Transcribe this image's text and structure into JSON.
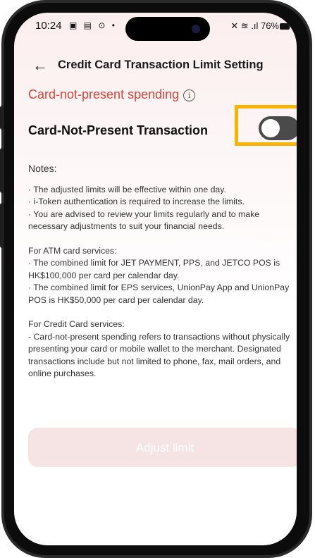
{
  "status_bar": {
    "time": "10:24",
    "left_icons": "▣ ▤ ⊙ •",
    "right_icons": "✕ ≋ .ıl",
    "battery": "76%"
  },
  "header": {
    "back_icon": "←",
    "title": "Credit Card Transaction Limit Setting"
  },
  "section": {
    "title": "Card-not-present spending",
    "info_icon": "i"
  },
  "toggle_row": {
    "label": "Card-Not-Present Transaction",
    "toggle_state": "off"
  },
  "notes": {
    "heading": "Notes:",
    "general": [
      "· The adjusted limits will be effective within one day.",
      "· i-Token authentication is required to increase the limits.",
      "· You are advised to review your limits regularly and to make necessary adjustments to suit your financial needs."
    ],
    "atm_heading": "For ATM card services:",
    "atm": [
      "· The combined limit for JET PAYMENT, PPS, and JETCO POS is HK$100,000 per card per calendar day.",
      "· The combined limit for EPS services, UnionPay App and UnionPay POS is HK$50,000 per card per calendar day."
    ],
    "credit_heading": "For Credit Card services:",
    "credit": [
      "- Card-not-present spending refers to transactions without physically presenting your card or mobile wallet to the merchant. Designated transactions include but not limited to phone, fax, mail orders, and online purchases."
    ]
  },
  "button": {
    "label": "Adjust limit"
  },
  "colors": {
    "accent": "#d8453a",
    "highlight": "#f7b500",
    "toggle_off": "#4a4a4a",
    "button_disabled": "#f6e3e3"
  }
}
